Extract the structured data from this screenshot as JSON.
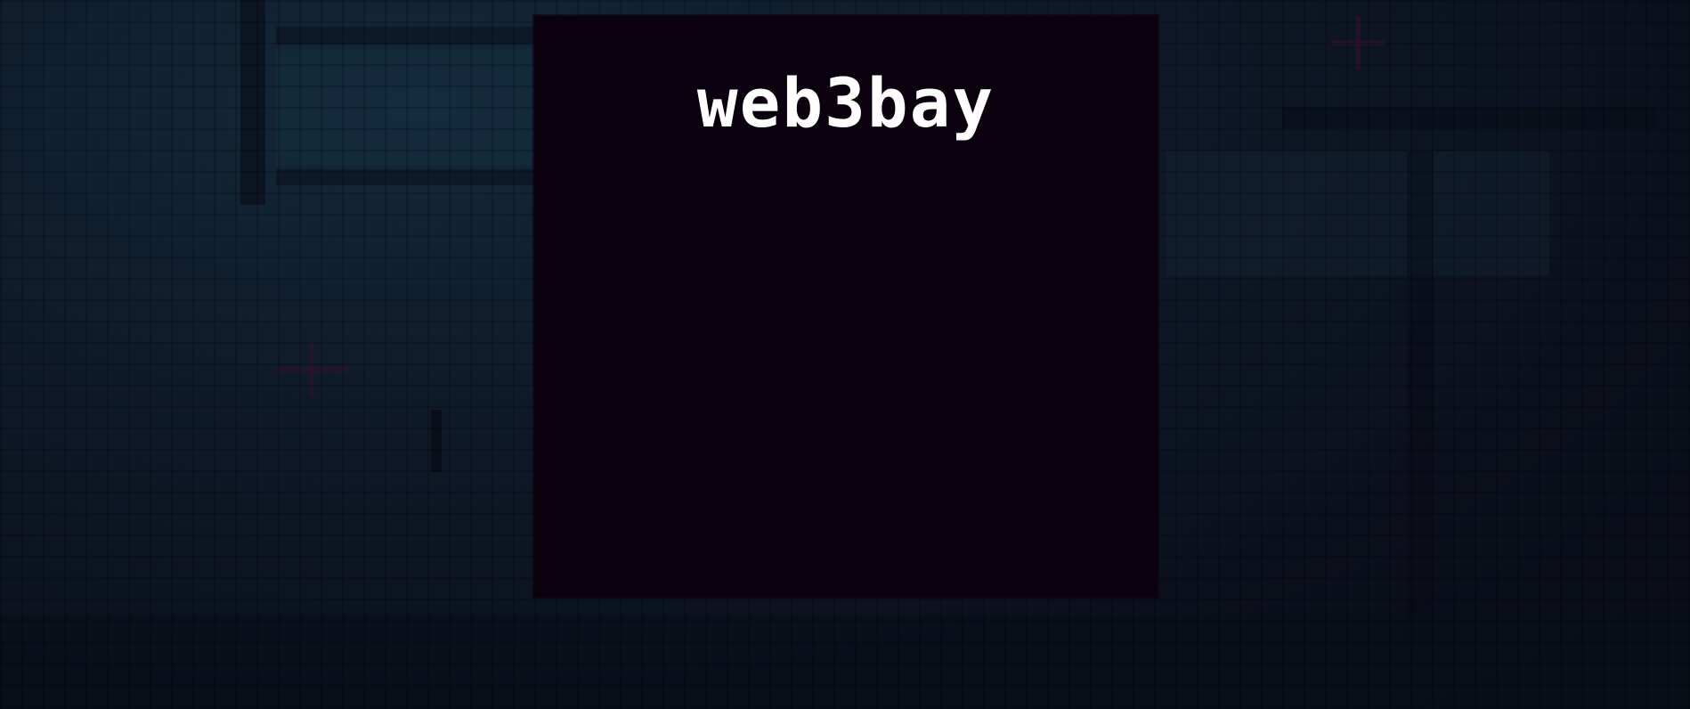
{
  "app": {
    "title": "web3bay"
  },
  "icons": {
    "background_markers": [
      "crosshair-icon",
      "crosshair-icon"
    ]
  },
  "colors": {
    "background": "#0b101c",
    "panel": "#0a000e",
    "title": "#ffffff"
  }
}
